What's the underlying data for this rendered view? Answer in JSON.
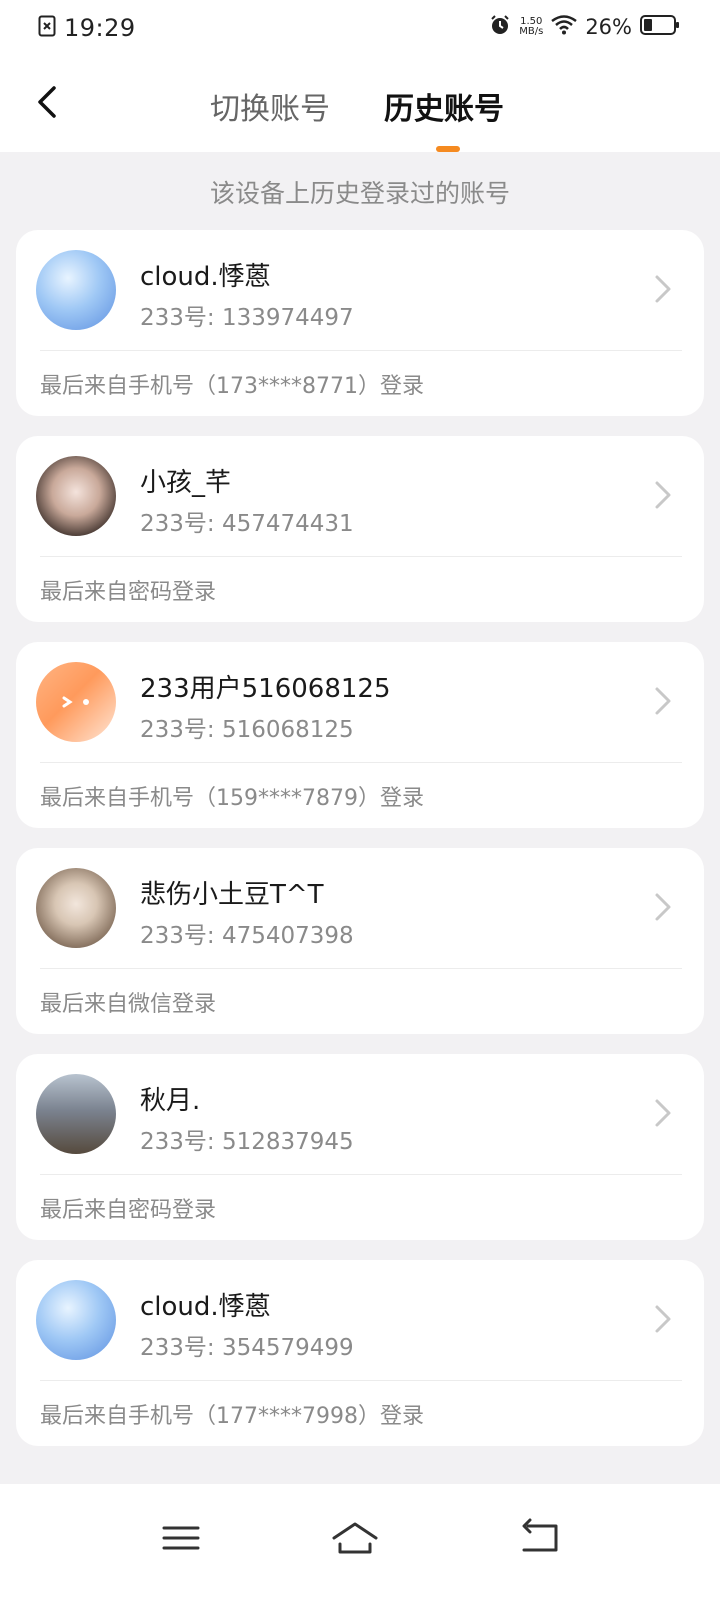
{
  "status_bar": {
    "time": "19:29",
    "speed_value": "1.50",
    "speed_unit": "MB/s",
    "battery_percent": "26%"
  },
  "header": {
    "tab_switch_label": "切换账号",
    "tab_history_label": "历史账号",
    "accent_color": "#f58a20"
  },
  "subtitle": "该设备上历史登录过的账号",
  "accounts": [
    {
      "name": "cloud.悸蒽",
      "id": "233号: 133974497",
      "source": "最后来自手机号（173****8771）登录"
    },
    {
      "name": "小孩_芊",
      "id": "233号: 457474431",
      "source": "最后来自密码登录"
    },
    {
      "name": "233用户516068125",
      "id": "233号: 516068125",
      "source": "最后来自手机号（159****7879）登录"
    },
    {
      "name": "悲伤小土豆T^T",
      "id": "233号: 475407398",
      "source": "最后来自微信登录"
    },
    {
      "name": "秋月.",
      "id": "233号: 512837945",
      "source": "最后来自密码登录"
    },
    {
      "name": "cloud.悸蒽",
      "id": "233号: 354579499",
      "source": "最后来自手机号（177****7998）登录"
    }
  ]
}
